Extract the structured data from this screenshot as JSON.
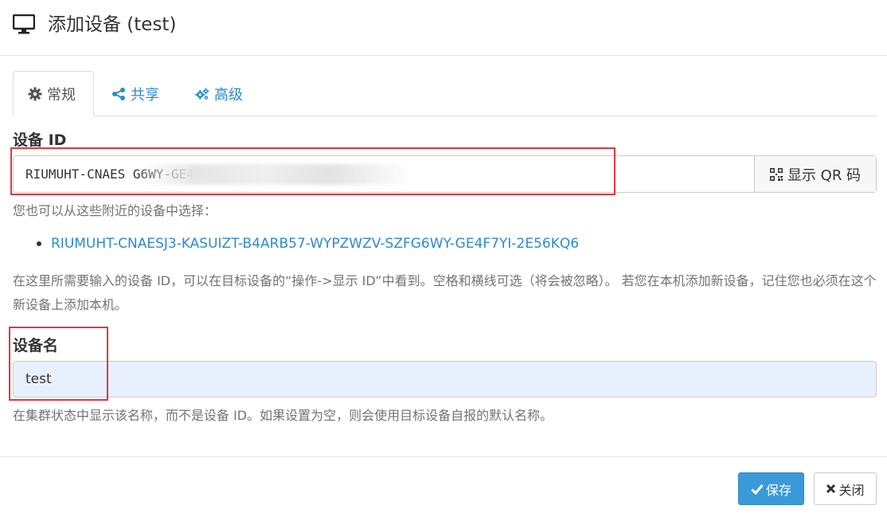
{
  "header": {
    "title": "添加设备 (test)",
    "icon": "desktop-icon"
  },
  "tabs": [
    {
      "label": "常规",
      "icon": "gear-icon",
      "active": true
    },
    {
      "label": "共享",
      "icon": "share-icon",
      "active": false
    },
    {
      "label": "高级",
      "icon": "gears-icon",
      "active": false
    }
  ],
  "device_id": {
    "label": "设备 ID",
    "value": "RIUMUHT-CNAES                                      G6WY-GE4F7YI-2E56KQ6",
    "qr_button_label": "显示 QR 码"
  },
  "nearby": {
    "help": "您也可以从这些附近的设备中选择：",
    "items": [
      "RIUMUHT-CNAESJ3-KASUIZT-B4ARB57-WYPZWZV-SZFG6WY-GE4F7YI-2E56KQ6"
    ]
  },
  "explanation": "在这里所需要输入的设备 ID，可以在目标设备的“操作->显示 ID”中看到。空格和横线可选（将会被忽略）。 若您在本机添加新设备，记住您也必须在这个新设备上添加本机。",
  "device_name": {
    "label": "设备名",
    "value": "test",
    "help": "在集群状态中显示该名称，而不是设备 ID。如果设置为空，则会使用目标设备自报的默认名称。"
  },
  "footer": {
    "save_label": "保存",
    "close_label": "关闭"
  },
  "colors": {
    "accent": "#3a9ad9",
    "link": "#2a8bd0",
    "highlight_box": "#e0393e",
    "autofill_bg": "#e8f0fe"
  }
}
